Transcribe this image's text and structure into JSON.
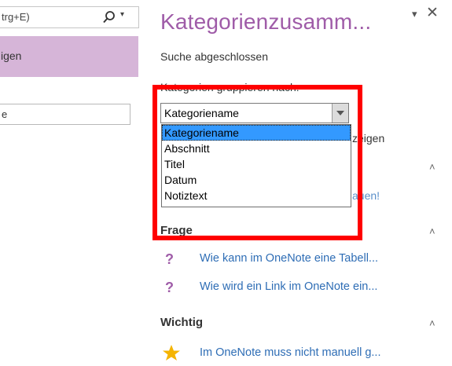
{
  "left": {
    "search_text": "trg+E)",
    "search_dropdown": "▾",
    "band_text": "igen",
    "field_text": "e"
  },
  "pane": {
    "title": "Kategorienzusamm...",
    "dropdown_glyph": "▾",
    "close_glyph": "✕",
    "status": "Suche abgeschlossen",
    "group_label": "Kategorien gruppieren nach:",
    "combo_value": "Kategoriename",
    "options": [
      "Kategoriename",
      "Abschnitt",
      "Titel",
      "Datum",
      "Notiztext"
    ],
    "behind_text_1": "zeigen",
    "behind_text_2": "auen!",
    "collapse_glyph": "˄"
  },
  "sections": [
    {
      "title": "Frage",
      "icon": "question-icon",
      "items": [
        "Wie kann im OneNote eine Tabell...",
        "Wie wird ein Link im OneNote ein..."
      ]
    },
    {
      "title": "Wichtig",
      "icon": "star-icon",
      "items": [
        "Im OneNote muss nicht manuell g..."
      ]
    }
  ],
  "colors": {
    "accent_purple": "#9f5ca8",
    "highlight_red": "#ff0000",
    "selection_blue": "#3399ff",
    "link_blue": "#2e6db5",
    "star_gold": "#f5b400"
  }
}
